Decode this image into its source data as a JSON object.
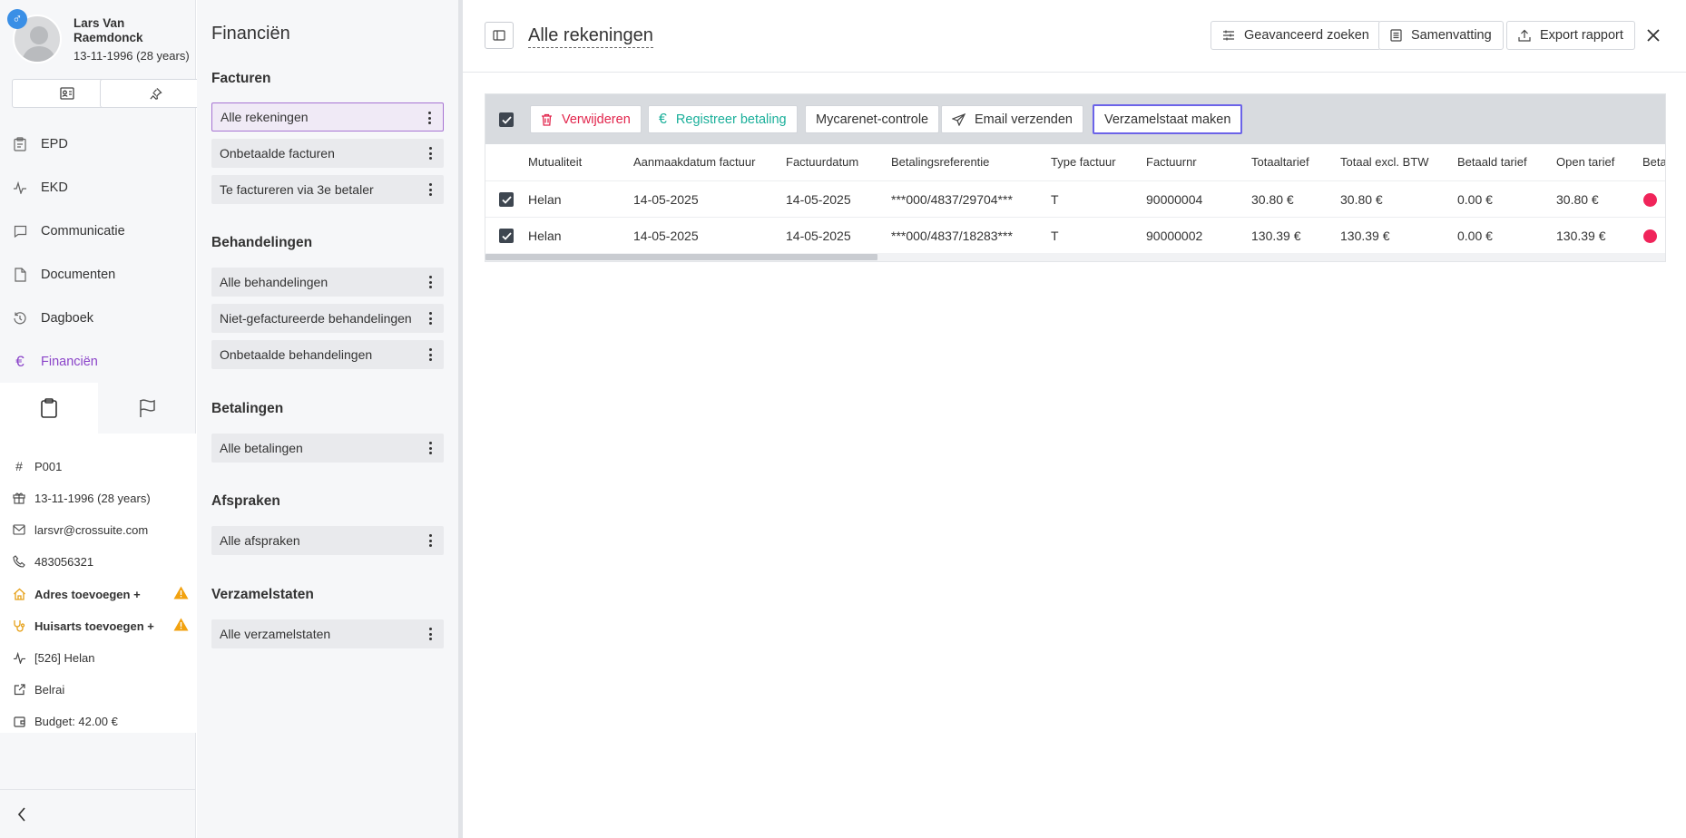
{
  "patient": {
    "name": "Lars Van Raemdonck",
    "dob": "13-11-1996 (28 years)",
    "gender_symbol": "♂"
  },
  "nav": [
    {
      "label": "EPD",
      "icon": "clipboard-icon"
    },
    {
      "label": "EKD",
      "icon": "pulse-icon"
    },
    {
      "label": "Communicatie",
      "icon": "chat-icon"
    },
    {
      "label": "Documenten",
      "icon": "document-icon"
    },
    {
      "label": "Dagboek",
      "icon": "history-icon"
    },
    {
      "label": "Financiën",
      "icon": "euro-icon",
      "active": true
    }
  ],
  "info": {
    "id": "P001",
    "dob": "13-11-1996 (28 years)",
    "email": "larsvr@crossuite.com",
    "phone": "483056321",
    "address": "Adres toevoegen +",
    "gp": "Huisarts toevoegen +",
    "insurer": "[526] Helan",
    "external": "Belrai",
    "budget": "Budget: 42.00 €"
  },
  "finance": {
    "title": "Financiën",
    "sections": [
      {
        "title": "Facturen",
        "items": [
          "Alle rekeningen",
          "Onbetaalde facturen",
          "Te factureren via 3e betaler"
        ]
      },
      {
        "title": "Behandelingen",
        "items": [
          "Alle behandelingen",
          "Niet-gefactureerde behandelingen",
          "Onbetaalde behandelingen"
        ]
      },
      {
        "title": "Betalingen",
        "items": [
          "Alle betalingen"
        ]
      },
      {
        "title": "Afspraken",
        "items": [
          "Alle afspraken"
        ]
      },
      {
        "title": "Verzamelstaten",
        "items": [
          "Alle verzamelstaten"
        ]
      }
    ]
  },
  "main": {
    "title": "Alle rekeningen",
    "top_buttons": {
      "advanced": "Geavanceerd zoeken",
      "summary": "Samenvatting",
      "export": "Export rapport"
    },
    "toolbar": {
      "delete": "Verwijderen",
      "register": "Registreer betaling",
      "mycarenet": "Mycarenet-controle",
      "email": "Email verzenden",
      "collect": "Verzamelstaat maken"
    },
    "columns": [
      "Mutualiteit",
      "Aanmaakdatum factuur",
      "Factuurdatum",
      "Betalingsreferentie",
      "Type factuur",
      "Factuurnr",
      "Totaaltarief",
      "Totaal excl. BTW",
      "Betaald tarief",
      "Open tarief",
      "Beta"
    ],
    "rows": [
      {
        "mutualiteit": "Helan",
        "created": "14-05-2025",
        "invoice_date": "14-05-2025",
        "reference": "***000/4837/29704***",
        "type": "T",
        "number": "90000004",
        "total": "30.80 €",
        "excl": "30.80 €",
        "paid": "0.00 €",
        "open": "30.80 €",
        "status_color": "#f0245a"
      },
      {
        "mutualiteit": "Helan",
        "created": "14-05-2025",
        "invoice_date": "14-05-2025",
        "reference": "***000/4837/18283***",
        "type": "T",
        "number": "90000002",
        "total": "130.39 €",
        "excl": "130.39 €",
        "paid": "0.00 €",
        "open": "130.39 €",
        "status_color": "#f0245a"
      }
    ]
  },
  "colors": {
    "accent": "#8b44c9",
    "danger": "#e2264d",
    "teal": "#1aaf9a",
    "focus": "#6b63e8"
  }
}
